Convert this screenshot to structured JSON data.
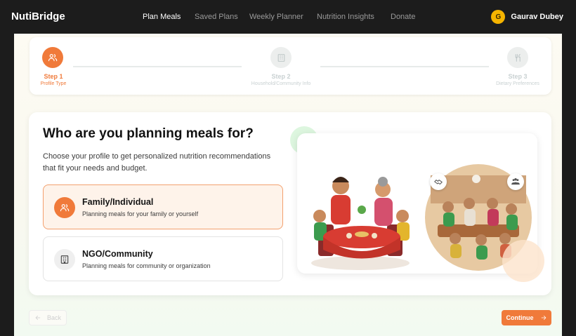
{
  "app": {
    "brand": "NutiBridge"
  },
  "nav": {
    "items": [
      {
        "label": "Plan Meals",
        "active": true
      },
      {
        "label": "Saved Plans",
        "active": false
      },
      {
        "label": "Weekly Planner",
        "active": false
      },
      {
        "label": "Nutrition Insights",
        "active": false
      },
      {
        "label": "Donate",
        "active": false
      }
    ]
  },
  "user": {
    "initial": "G",
    "name": "Gaurav Dubey"
  },
  "stepper": {
    "steps": [
      {
        "title": "Step 1",
        "subtitle": "Profile Type",
        "status": "active",
        "icon": "users-icon"
      },
      {
        "title": "Step 2",
        "subtitle": "Household/Community Info",
        "status": "inactive",
        "icon": "building-icon"
      },
      {
        "title": "Step 3",
        "subtitle": "Dietary Preferences",
        "status": "inactive",
        "icon": "utensils-icon"
      }
    ]
  },
  "main": {
    "title": "Who are you planning meals for?",
    "description": "Choose your profile to get personalized nutrition recommendations that fit your needs and budget.",
    "options": [
      {
        "title": "Family/Individual",
        "subtitle": "Planning meals for your family or yourself",
        "selected": true,
        "icon": "users-icon"
      },
      {
        "title": "NGO/Community",
        "subtitle": "Planning meals for community or organization",
        "selected": false,
        "icon": "building-icon"
      }
    ]
  },
  "illustration": {
    "badges": [
      "handshake-icon",
      "group-icon"
    ]
  },
  "actions": {
    "back_label": "Back",
    "continue_label": "Continue"
  },
  "colors": {
    "accent": "#f07a3a",
    "selected_bg": "#fef3ea",
    "topbar": "#1c1c1c"
  }
}
